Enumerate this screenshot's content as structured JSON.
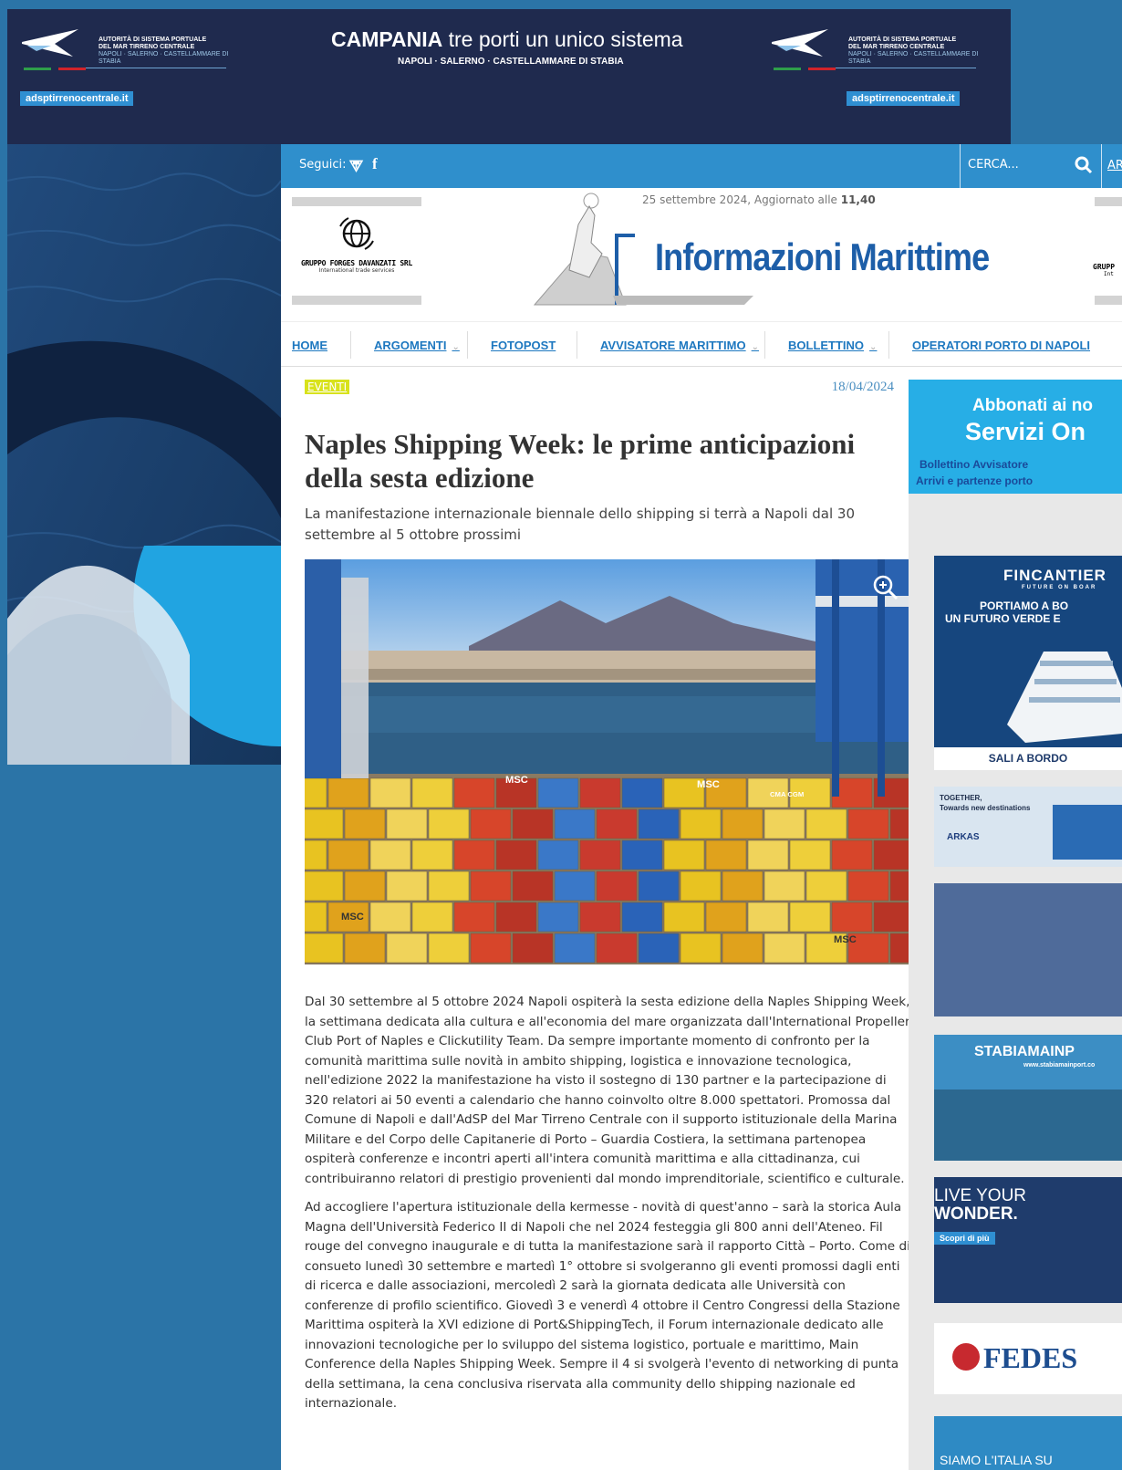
{
  "top_ad": {
    "authority": "AUTORITÀ DI SISTEMA PORTUALE",
    "authority_line2": "DEL MAR TIRRENO CENTRALE",
    "authority_ports": "NAPOLI · SALERNO · CASTELLAMMARE DI STABIA",
    "website": "adsptirrenocentrale.it",
    "headline_bold": "CAMPANIA",
    "headline_rest": " tre porti un unico sistema",
    "sub": "NAPOLI · SALERNO · CASTELLAMMARE DI STABIA"
  },
  "topbar": {
    "follow_label": "Seguici:",
    "rss_icon": "⮗",
    "facebook_icon": "f",
    "search_placeholder": "CERCA...",
    "archive_link": "AR"
  },
  "masthead": {
    "date_text": "25 settembre 2024, Aggiornato alle ",
    "updated_time": "11,40",
    "title": "Informazioni Marittime",
    "sponsor_name": "GRUPPO FORGES DAVANZATI SRL",
    "sponsor_tagline": "International trade services",
    "sponsor_name_right": "GRUPP",
    "sponsor_tagline_right": "Int"
  },
  "nav": {
    "items": [
      {
        "label": "HOME",
        "dropdown": false
      },
      {
        "label": "ARGOMENTI",
        "dropdown": true
      },
      {
        "label": "FOTOPOST",
        "dropdown": false
      },
      {
        "label": "AVVISATORE MARITTIMO",
        "dropdown": true
      },
      {
        "label": "BOLLETTINO",
        "dropdown": true
      },
      {
        "label": "OPERATORI PORTO DI NAPOLI",
        "dropdown": false
      }
    ],
    "chevron": "⌄"
  },
  "article": {
    "category": "EVENTI",
    "date": "18/04/2024",
    "title": "Naples Shipping Week: le prime anticipazioni della sesta edizione",
    "subtitle": "La manifestazione internazionale biennale dello shipping si terrà a Napoli dal 30 settembre al 5 ottobre prossimi",
    "paragraphs": [
      "Dal 30 settembre al 5 ottobre 2024 Napoli ospiterà la sesta edizione della Naples Shipping Week, la settimana dedicata alla cultura e all'economia del mare organizzata dall'International Propeller Club Port of Naples e Clickutility Team. Da sempre importante momento di confronto per la comunità marittima sulle novità in ambito shipping, logistica e innovazione tecnologica, nell'edizione 2022 la manifestazione ha visto il sostegno di 130 partner e la partecipazione di 320 relatori ai 50 eventi a calendario che hanno coinvolto oltre 8.000 spettatori. Promossa dal Comune di Napoli e dall'AdSP del Mar Tirreno Centrale con il supporto istituzionale della Marina Militare e del Corpo delle Capitanerie di Porto – Guardia Costiera, la settimana partenopea ospiterà conferenze e incontri aperti all'intera comunità marittima e alla cittadinanza, cui contribuiranno relatori di prestigio provenienti dal mondo imprenditoriale, scientifico e culturale.",
      "Ad accogliere l'apertura istituzionale della kermesse - novità di quest'anno – sarà la storica Aula Magna dell'Università Federico II di Napoli che nel 2024 festeggia gli 800 anni dell'Ateneo. Fil rouge del convegno inaugurale e di tutta la manifestazione sarà il rapporto Città – Porto. Come di consueto lunedì 30 settembre e martedì 1° ottobre si svolgeranno gli eventi promossi dagli enti di ricerca e dalle associazioni, mercoledì 2 sarà la giornata dedicata alle Università con conferenze di profilo scientifico. Giovedì 3 e venerdì 4 ottobre il Centro Congressi della Stazione Marittima ospiterà la XVI edizione di Port&ShippingTech, il Forum internazionale dedicato alle innovazioni tecnologiche per lo sviluppo del sistema logistico, portuale e marittimo, Main Conference della Naples Shipping Week. Sempre il 4 si svolgerà l'evento di networking di punta della settimana, la cena conclusiva riservata alla community dello shipping nazionale ed internazionale."
    ],
    "photo_labels": [
      "MSC",
      "MSC",
      "MSC",
      "MSC",
      "CMA CGM"
    ]
  },
  "sidebar": {
    "subscribe_line1": "Abbonati ai no",
    "subscribe_line2": "Servizi On",
    "subscribe_line3": "Bollettino Avvisatore",
    "subscribe_line4": "Arrivi e partenze porto",
    "ads": {
      "fincantieri_brand": "FINCANTIER",
      "fincantieri_tag": "FUTURE ON BOAR",
      "fincantieri_line1": "PORTIAMO A BO",
      "fincantieri_line2": "UN FUTURO VERDE E",
      "fincantieri_cta": "SALI A BORDO",
      "arkas_line1": "TOGETHER,",
      "arkas_line2": "Towards new destinations",
      "arkas_brand": "ARKAS",
      "stabia_brand": "STABIAMAINP",
      "stabia_url": "www.stabiamainport.co",
      "wonder_line1": "LIVE YOUR",
      "wonder_line2": "WONDER.",
      "wonder_cta": "Scopri di più",
      "fedes_brand": "FEDES",
      "last_text": "SIAMO L'ITALIA SU"
    }
  },
  "colors": {
    "topbar": "#2f8fcc",
    "nav_link": "#1e78c0",
    "category_badge": "#d8e21c",
    "masthead_title": "#1d5ea8",
    "sidebar_subscribe": "#27aee6"
  }
}
